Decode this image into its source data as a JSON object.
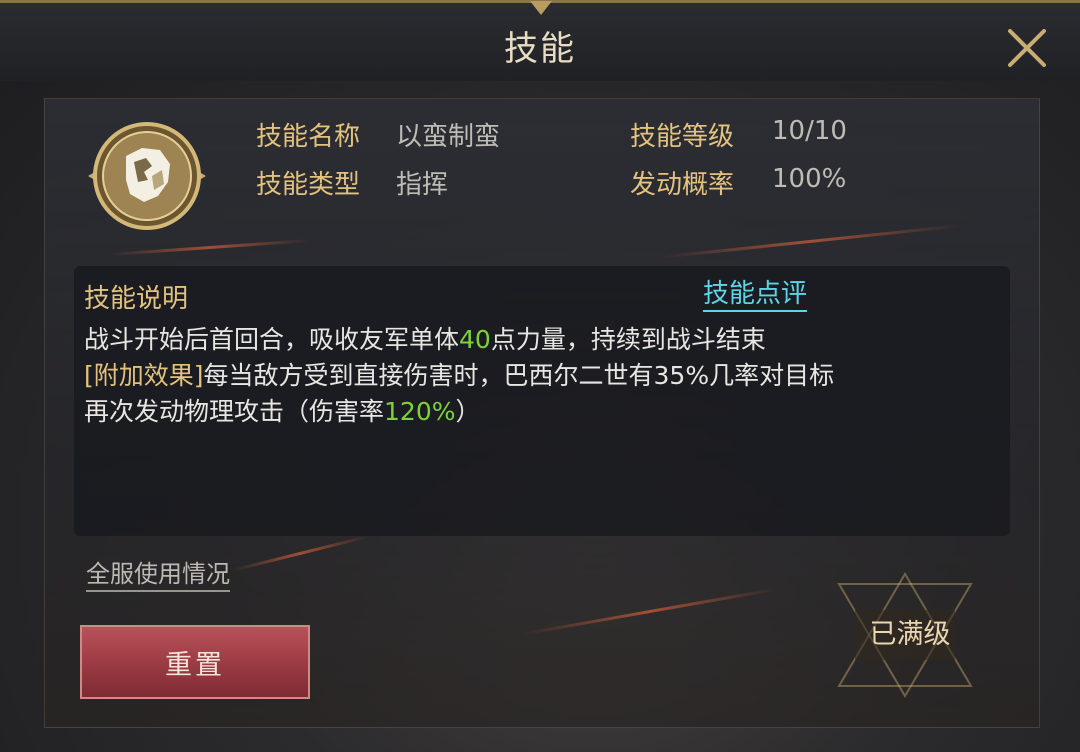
{
  "window": {
    "title": "技能"
  },
  "skill": {
    "name_label": "技能名称",
    "name": "以蛮制蛮",
    "type_label": "技能类型",
    "type": "指挥",
    "level_label": "技能等级",
    "level": "10/10",
    "rate_label": "发动概率",
    "rate": "100%",
    "icon": "commander-portrait-badge"
  },
  "description": {
    "title": "技能说明",
    "review_link": "技能点评",
    "line1_a": "战斗开始后首回合，吸收友军单体",
    "line1_value": "40",
    "line1_b": "点力量，持续到战斗结束",
    "line2_tag": "[附加效果]",
    "line2_text": "每当敌方受到直接伤害时，巴西尔二世有35%几率对目标",
    "line3_a": "再次发动物理攻击（伤害率",
    "line3_value": "120%",
    "line3_b": "）"
  },
  "footer": {
    "usage_link": "全服使用情况",
    "reset_button": "重置",
    "max_level_badge": "已满级"
  },
  "colors": {
    "accent_gold": "#e2c27e",
    "link_cyan": "#5fd4e6",
    "highlight_green": "#7dd23a",
    "button_red": "#9a3a42"
  }
}
